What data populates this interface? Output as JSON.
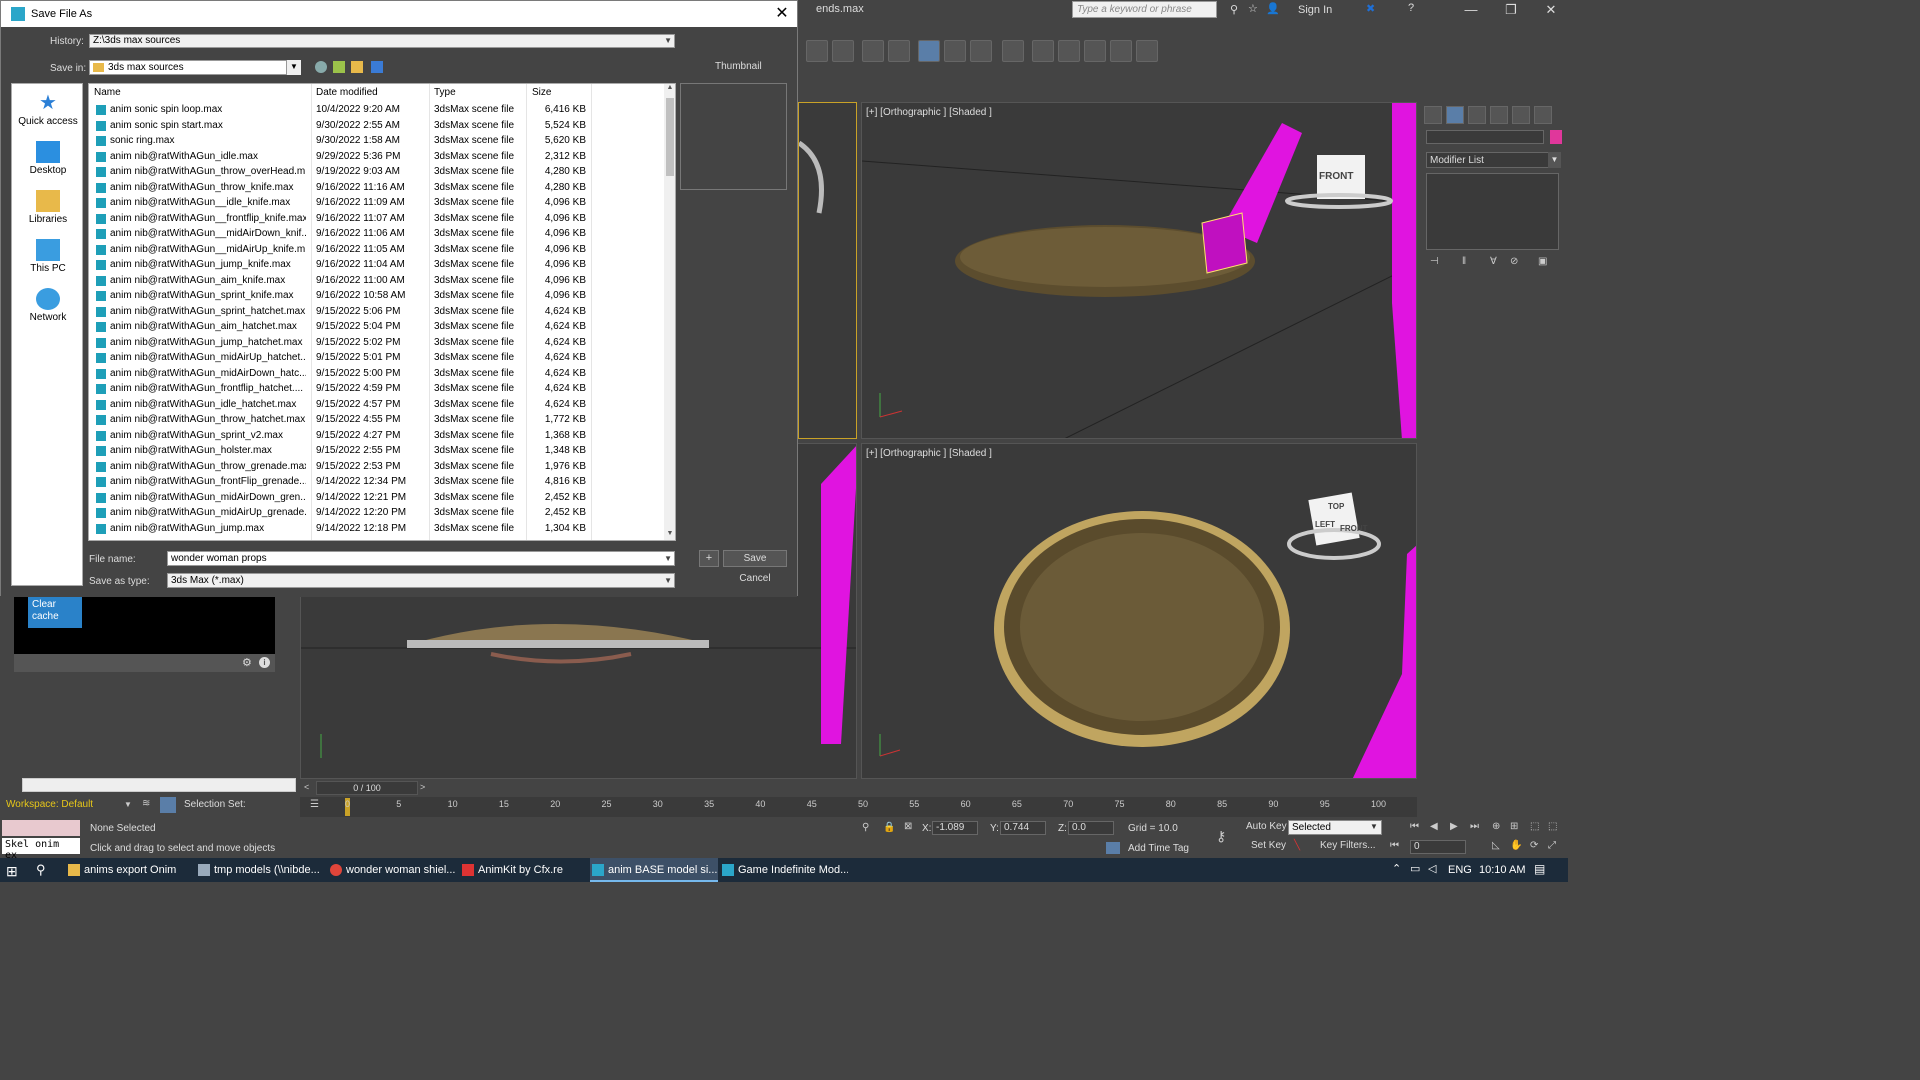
{
  "max_window": {
    "title": "ends.max",
    "search_placeholder": "Type a keyword or phrase",
    "sign_in": "Sign In",
    "minimize": "—",
    "maximize": "❐",
    "close": "✕"
  },
  "viewports": {
    "top_right_label": "[+] [Orthographic ] [Shaded ]",
    "bottom_right_label": "[+] [Orthographic ] [Shaded ]",
    "viewcube_top_face": "FRONT",
    "viewcube_bottom_top": "TOP",
    "viewcube_bottom_left": "LEFT",
    "viewcube_bottom_front": "FRONT"
  },
  "command_panel": {
    "modifier_list": "Modifier List",
    "color_swatch": "#e0379b"
  },
  "left_panel": {
    "clear_cache_button": "Clear cache"
  },
  "time_slider": {
    "position": "0 / 100",
    "ticks": [
      "0",
      "5",
      "10",
      "15",
      "20",
      "25",
      "30",
      "35",
      "40",
      "45",
      "50",
      "55",
      "60",
      "65",
      "70",
      "75",
      "80",
      "85",
      "90",
      "95",
      "100"
    ]
  },
  "workspace": {
    "label": "Workspace: Default",
    "selection_set": "Selection Set:"
  },
  "status_bar": {
    "maxscript_text": "Skel onim ex",
    "selection_status": "None Selected",
    "hint": "Click and drag to select and move objects",
    "x_label": "X:",
    "x_value": "-1.089",
    "y_label": "Y:",
    "y_value": "0.744",
    "z_label": "Z:",
    "z_value": "0.0",
    "grid": "Grid = 10.0",
    "add_time_tag": "Add Time Tag",
    "auto_key": "Auto Key",
    "set_key": "Set Key",
    "selected_dropdown": "Selected",
    "key_filters": "Key Filters...",
    "frame_value": "0"
  },
  "taskbar": {
    "items": [
      {
        "label": "anims export Onim",
        "color": "#e8b94a"
      },
      {
        "label": "tmp models (\\\\nibde...",
        "color": "#9ab"
      },
      {
        "label": "wonder woman shiel...",
        "color": "#e0453a"
      },
      {
        "label": "AnimKit by Cfx.re",
        "color": "#d33"
      },
      {
        "label": "anim BASE model si...",
        "color": "#2ba6c9"
      },
      {
        "label": "Game Indefinite Mod...",
        "color": "#2ba6c9"
      }
    ],
    "language": "ENG",
    "time": "10:10 AM"
  },
  "dialog": {
    "title": "Save File As",
    "history_label": "History:",
    "history_value": "Z:\\3ds max sources",
    "save_in_label": "Save in:",
    "save_in_value": "3ds max sources",
    "thumbnail_label": "Thumbnail",
    "places": [
      {
        "label": "Quick access",
        "icon": "star-icon"
      },
      {
        "label": "Desktop",
        "icon": "desktop-icon"
      },
      {
        "label": "Libraries",
        "icon": "libraries-icon"
      },
      {
        "label": "This PC",
        "icon": "computer-icon"
      },
      {
        "label": "Network",
        "icon": "network-icon"
      }
    ],
    "columns": {
      "name": "Name",
      "date": "Date modified",
      "type": "Type",
      "size": "Size"
    },
    "files": [
      {
        "name": "anim sonic spin loop.max",
        "date": "10/4/2022 9:20 AM",
        "type": "3dsMax scene file",
        "size": "6,416 KB"
      },
      {
        "name": "anim sonic spin start.max",
        "date": "9/30/2022 2:55 AM",
        "type": "3dsMax scene file",
        "size": "5,524 KB"
      },
      {
        "name": "sonic ring.max",
        "date": "9/30/2022 1:58 AM",
        "type": "3dsMax scene file",
        "size": "5,620 KB"
      },
      {
        "name": "anim nib@ratWithAGun_idle.max",
        "date": "9/29/2022 5:36 PM",
        "type": "3dsMax scene file",
        "size": "2,312 KB"
      },
      {
        "name": "anim nib@ratWithAGun_throw_overHead.m...",
        "date": "9/19/2022 9:03 AM",
        "type": "3dsMax scene file",
        "size": "4,280 KB"
      },
      {
        "name": "anim nib@ratWithAGun_throw_knife.max",
        "date": "9/16/2022 11:16 AM",
        "type": "3dsMax scene file",
        "size": "4,280 KB"
      },
      {
        "name": "anim nib@ratWithAGun__idle_knife.max",
        "date": "9/16/2022 11:09 AM",
        "type": "3dsMax scene file",
        "size": "4,096 KB"
      },
      {
        "name": "anim nib@ratWithAGun__frontflip_knife.max",
        "date": "9/16/2022 11:07 AM",
        "type": "3dsMax scene file",
        "size": "4,096 KB"
      },
      {
        "name": "anim nib@ratWithAGun__midAirDown_knif...",
        "date": "9/16/2022 11:06 AM",
        "type": "3dsMax scene file",
        "size": "4,096 KB"
      },
      {
        "name": "anim nib@ratWithAGun__midAirUp_knife.m...",
        "date": "9/16/2022 11:05 AM",
        "type": "3dsMax scene file",
        "size": "4,096 KB"
      },
      {
        "name": "anim nib@ratWithAGun_jump_knife.max",
        "date": "9/16/2022 11:04 AM",
        "type": "3dsMax scene file",
        "size": "4,096 KB"
      },
      {
        "name": "anim nib@ratWithAGun_aim_knife.max",
        "date": "9/16/2022 11:00 AM",
        "type": "3dsMax scene file",
        "size": "4,096 KB"
      },
      {
        "name": "anim nib@ratWithAGun_sprint_knife.max",
        "date": "9/16/2022 10:58 AM",
        "type": "3dsMax scene file",
        "size": "4,096 KB"
      },
      {
        "name": "anim nib@ratWithAGun_sprint_hatchet.max",
        "date": "9/15/2022 5:06 PM",
        "type": "3dsMax scene file",
        "size": "4,624 KB"
      },
      {
        "name": "anim nib@ratWithAGun_aim_hatchet.max",
        "date": "9/15/2022 5:04 PM",
        "type": "3dsMax scene file",
        "size": "4,624 KB"
      },
      {
        "name": "anim nib@ratWithAGun_jump_hatchet.max",
        "date": "9/15/2022 5:02 PM",
        "type": "3dsMax scene file",
        "size": "4,624 KB"
      },
      {
        "name": "anim nib@ratWithAGun_midAirUp_hatchet....",
        "date": "9/15/2022 5:01 PM",
        "type": "3dsMax scene file",
        "size": "4,624 KB"
      },
      {
        "name": "anim nib@ratWithAGun_midAirDown_hatc...",
        "date": "9/15/2022 5:00 PM",
        "type": "3dsMax scene file",
        "size": "4,624 KB"
      },
      {
        "name": "anim nib@ratWithAGun_frontflip_hatchet....",
        "date": "9/15/2022 4:59 PM",
        "type": "3dsMax scene file",
        "size": "4,624 KB"
      },
      {
        "name": "anim nib@ratWithAGun_idle_hatchet.max",
        "date": "9/15/2022 4:57 PM",
        "type": "3dsMax scene file",
        "size": "4,624 KB"
      },
      {
        "name": "anim nib@ratWithAGun_throw_hatchet.max",
        "date": "9/15/2022 4:55 PM",
        "type": "3dsMax scene file",
        "size": "1,772 KB"
      },
      {
        "name": "anim nib@ratWithAGun_sprint_v2.max",
        "date": "9/15/2022 4:27 PM",
        "type": "3dsMax scene file",
        "size": "1,368 KB"
      },
      {
        "name": "anim nib@ratWithAGun_holster.max",
        "date": "9/15/2022 2:55 PM",
        "type": "3dsMax scene file",
        "size": "1,348 KB"
      },
      {
        "name": "anim nib@ratWithAGun_throw_grenade.max",
        "date": "9/15/2022 2:53 PM",
        "type": "3dsMax scene file",
        "size": "1,976 KB"
      },
      {
        "name": "anim nib@ratWithAGun_frontFlip_grenade....",
        "date": "9/14/2022 12:34 PM",
        "type": "3dsMax scene file",
        "size": "4,816 KB"
      },
      {
        "name": "anim nib@ratWithAGun_midAirDown_gren...",
        "date": "9/14/2022 12:21 PM",
        "type": "3dsMax scene file",
        "size": "2,452 KB"
      },
      {
        "name": "anim nib@ratWithAGun_midAirUp_grenade.max",
        "date": "9/14/2022 12:20 PM",
        "type": "3dsMax scene file",
        "size": "2,452 KB"
      },
      {
        "name": "anim nib@ratWithAGun_jump.max",
        "date": "9/14/2022 12:18 PM",
        "type": "3dsMax scene file",
        "size": "1,304 KB"
      }
    ],
    "file_name_label": "File name:",
    "file_name_value": "wonder woman props",
    "save_type_label": "Save as type:",
    "save_type_value": "3ds Max (*.max)",
    "plus_button": "+",
    "save_button": "Save",
    "cancel_button": "Cancel"
  }
}
